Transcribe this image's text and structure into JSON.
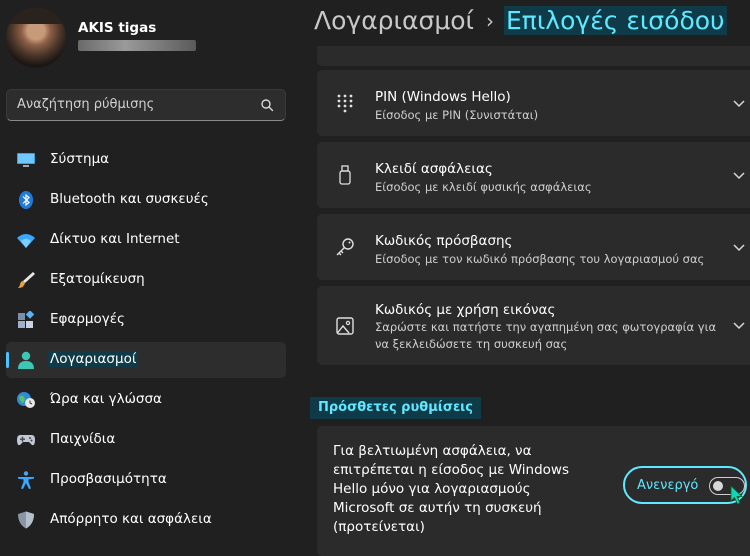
{
  "profile": {
    "name": "AKIS tigas"
  },
  "search": {
    "placeholder": "Αναζήτηση ρύθμισης"
  },
  "nav": {
    "items": [
      {
        "label": "Σύστημα",
        "icon": "monitor-icon"
      },
      {
        "label": "Bluetooth και συσκευές",
        "icon": "bluetooth-icon"
      },
      {
        "label": "Δίκτυο και Internet",
        "icon": "wifi-icon"
      },
      {
        "label": "Εξατομίκευση",
        "icon": "brush-icon"
      },
      {
        "label": "Εφαρμογές",
        "icon": "apps-icon"
      },
      {
        "label": "Λογαριασμοί",
        "icon": "person-icon",
        "active": true
      },
      {
        "label": "Ώρα και γλώσσα",
        "icon": "globe-clock-icon"
      },
      {
        "label": "Παιχνίδια",
        "icon": "gamepad-icon"
      },
      {
        "label": "Προσβασιμότητα",
        "icon": "accessibility-icon"
      },
      {
        "label": "Απόρρητο και ασφάλεια",
        "icon": "shield-icon"
      }
    ]
  },
  "header": {
    "parent": "Λογαριασμοί",
    "separator": "›",
    "current": "Επιλογές εισόδου"
  },
  "options": [
    {
      "title": "PIN (Windows Hello)",
      "desc": "Είσοδος με PIN (Συνιστάται)",
      "icon": "keypad-icon"
    },
    {
      "title": "Κλειδί ασφάλειας",
      "desc": "Είσοδος με κλειδί φυσικής ασφάλειας",
      "icon": "usb-key-icon"
    },
    {
      "title": "Κωδικός πρόσβασης",
      "desc": "Είσοδος με τον κωδικό πρόσβασης του λογαριασμού σας",
      "icon": "key-icon"
    },
    {
      "title": "Κωδικός με χρήση εικόνας",
      "desc": "Σαρώστε και πατήστε την αγαπημένη σας φωτογραφία για να ξεκλειδώσετε τη συσκευή σας",
      "icon": "picture-icon"
    }
  ],
  "additional": {
    "section_title": "Πρόσθετες ρυθμίσεις",
    "text": "Για βελτιωμένη ασφάλεια, να επιτρέπεται η είσοδος με Windows Hello μόνο για λογαριασμούς Microsoft σε αυτήν τη συσκευή (προτείνεται)",
    "toggle_label": "Ανενεργό",
    "toggle_on": false
  },
  "colors": {
    "accent": "#4cc2ff",
    "highlight": "#5fe8ff",
    "highlight_bg": "#0f3b48",
    "card": "#2b2b2b",
    "background": "#202020"
  }
}
